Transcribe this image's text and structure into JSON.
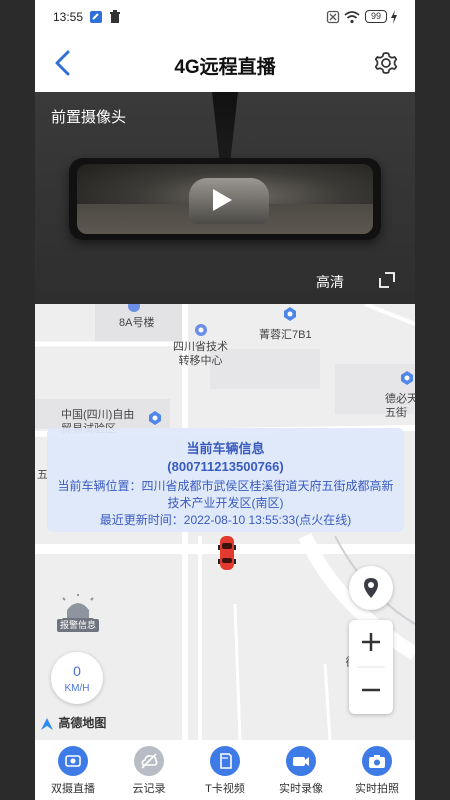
{
  "status_bar": {
    "time": "13:55",
    "battery": "99"
  },
  "header": {
    "title": "4G远程直播"
  },
  "video": {
    "camera_label": "前置摄像头",
    "quality_label": "高清"
  },
  "map": {
    "labels": [
      "8A号楼",
      "四川省技术\n转移中心",
      "菁蓉汇7B1",
      "中国(四川)自由\n贸易试验区",
      "德必天\n五街",
      "五",
      "德"
    ],
    "vehicle_info": {
      "title": "当前车辆信息",
      "device_id": "(800711213500766)",
      "location_line": "当前车辆位置：四川省成都市武侯区桂溪街道天府五街成都高新技术产业开发区(南区)",
      "update_line": "最近更新时间：2022-08-10 13:55:33(点火在线)"
    },
    "alarm_label": "报警信息",
    "speed": {
      "value": "0",
      "unit": "KM/H"
    },
    "logo_text": "高德地图"
  },
  "bottom_nav": {
    "items": [
      {
        "label": "双摄直播",
        "icon": "dual-camera-icon"
      },
      {
        "label": "云记录",
        "icon": "cloud-record-icon"
      },
      {
        "label": "T卡视频",
        "icon": "sd-card-icon"
      },
      {
        "label": "实时录像",
        "icon": "video-camera-icon"
      },
      {
        "label": "实时拍照",
        "icon": "photo-camera-icon"
      }
    ]
  },
  "colors": {
    "accent": "#3f7be6",
    "info_text": "#3a5bc0",
    "disabled": "#b8bcc4"
  }
}
